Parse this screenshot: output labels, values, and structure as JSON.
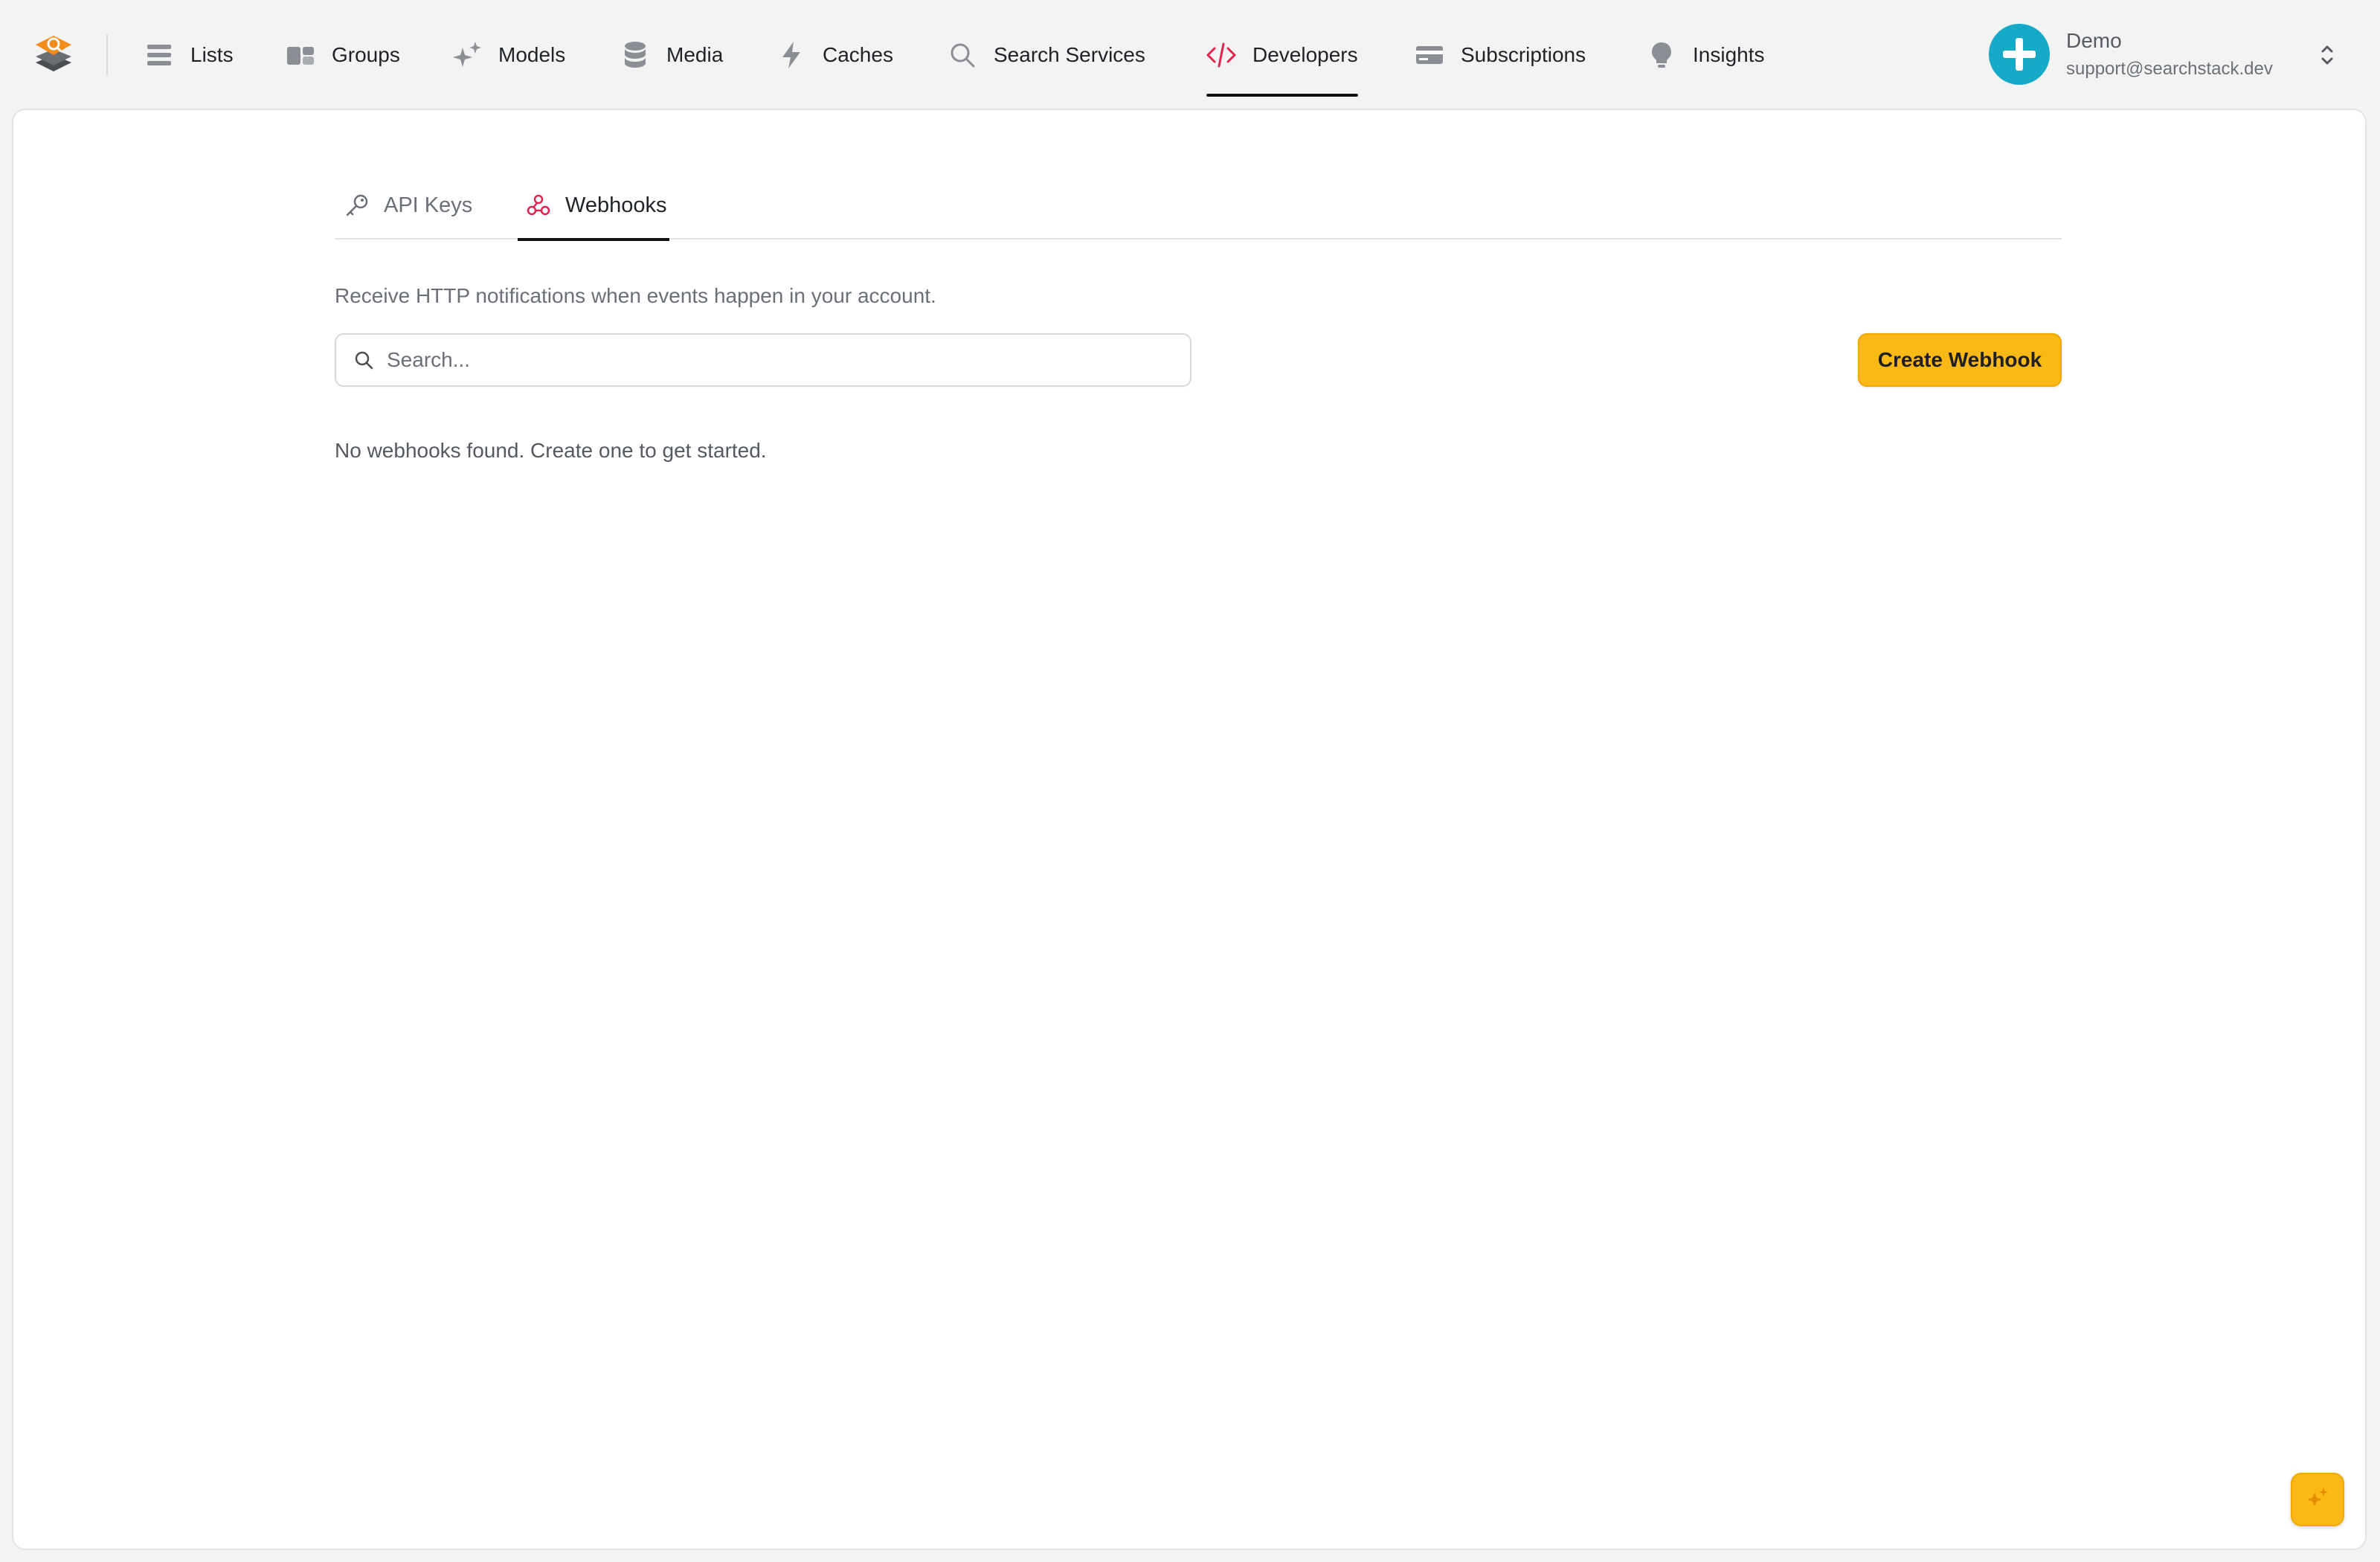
{
  "app": {
    "logo_icon": "searchstack-logo-icon",
    "accent_color": "#fbb917",
    "active_color": "#e0244e"
  },
  "nav": {
    "items": [
      {
        "label": "Lists",
        "icon": "list-icon"
      },
      {
        "label": "Groups",
        "icon": "groups-icon"
      },
      {
        "label": "Models",
        "icon": "sparkles-icon"
      },
      {
        "label": "Media",
        "icon": "database-icon"
      },
      {
        "label": "Caches",
        "icon": "lightning-icon"
      },
      {
        "label": "Search Services",
        "icon": "search-icon"
      },
      {
        "label": "Developers",
        "icon": "code-icon",
        "active": true
      },
      {
        "label": "Subscriptions",
        "icon": "credit-card-icon"
      },
      {
        "label": "Insights",
        "icon": "lightbulb-icon"
      }
    ]
  },
  "account": {
    "name": "Demo",
    "email": "support@searchstack.dev",
    "avatar_icon": "plus-icon",
    "avatar_color": "#16a9c8"
  },
  "developers": {
    "tabs": [
      {
        "label": "API Keys",
        "icon": "key-icon"
      },
      {
        "label": "Webhooks",
        "icon": "webhook-icon",
        "active": true
      }
    ],
    "description": "Receive HTTP notifications when events happen in your account.",
    "search": {
      "placeholder": "Search...",
      "value": ""
    },
    "create_button": "Create Webhook",
    "empty_state": "No webhooks found. Create one to get started."
  },
  "assistant": {
    "icon": "sparkles-icon"
  }
}
